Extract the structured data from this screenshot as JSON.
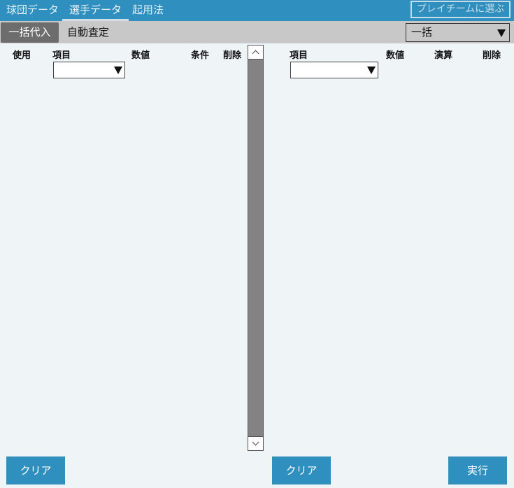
{
  "tabs": [
    {
      "label": "球団データ",
      "active": false
    },
    {
      "label": "選手データ",
      "active": true
    },
    {
      "label": "起用法",
      "active": false
    }
  ],
  "pick_team_button": "プレイチームに選ぶ",
  "toolbar": {
    "bulk_assign_button": "一括代入",
    "title": "自動査定",
    "mode_select": {
      "value": "一括"
    }
  },
  "left_panel": {
    "headers": {
      "use": "使用",
      "item": "項目",
      "value": "数値",
      "condition": "条件",
      "delete": "削除"
    },
    "item_dropdown": {
      "value": ""
    }
  },
  "right_panel": {
    "headers": {
      "item": "項目",
      "value": "数値",
      "operation": "演算",
      "delete": "削除"
    },
    "item_dropdown": {
      "value": ""
    }
  },
  "buttons": {
    "left_clear": "クリア",
    "right_clear": "クリア",
    "execute": "実行"
  },
  "colors": {
    "accent": "#2f8fbe",
    "background": "#eff4f7",
    "toolbar": "#c8c8c8",
    "bulk_button": "#6d6d6d",
    "scroll_track": "#838383"
  },
  "icons": {
    "dropdown_arrow": "triangle-down-icon",
    "scroll_up": "chevron-up-icon",
    "scroll_down": "chevron-down-icon"
  }
}
